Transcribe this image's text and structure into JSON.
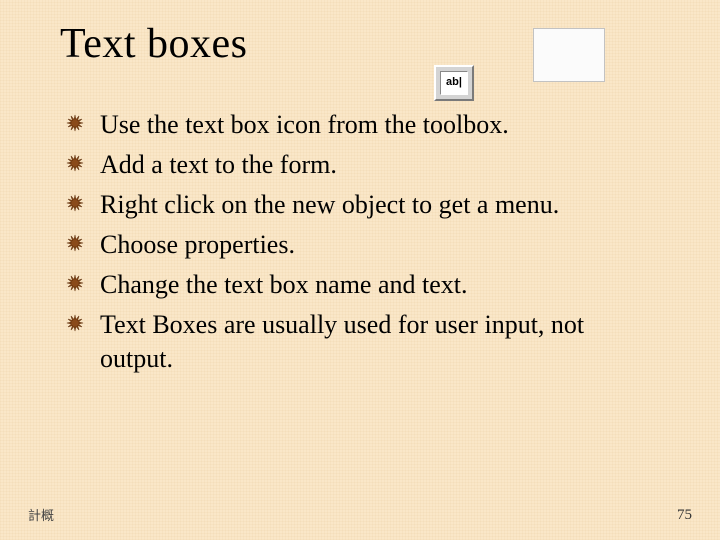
{
  "title": "Text boxes",
  "toolbox_icon_label": "ab|",
  "bullets": [
    "Use the text box icon from the toolbox.",
    "Add a text to the form.",
    "Right click on the new object to get a menu.",
    "Choose properties.",
    "Change the text box name and text.",
    "Text Boxes are usually used for user input, not output."
  ],
  "footer_left": "計概",
  "page_number": "75",
  "colors": {
    "bullet_fill": "#8a4a1a",
    "bullet_stroke": "#5e2f0c",
    "background": "#fae7c8"
  }
}
